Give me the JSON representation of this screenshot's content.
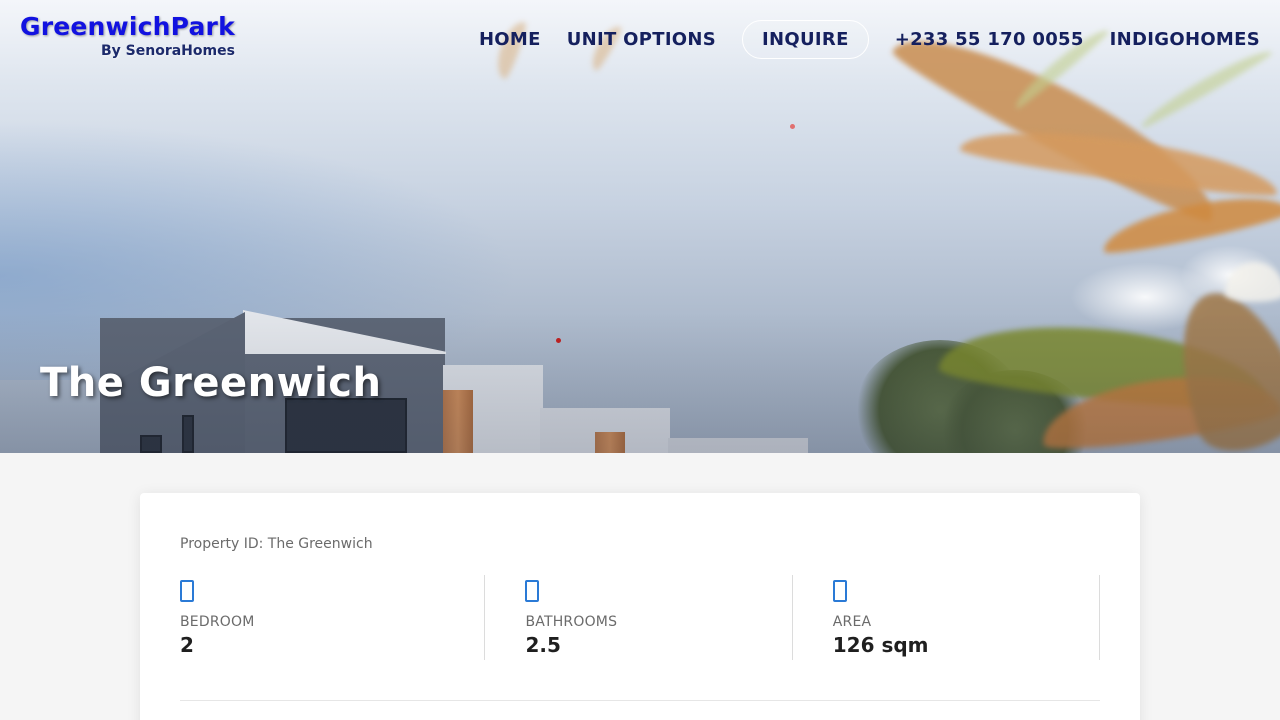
{
  "header": {
    "brand_name": "GreenwichPark",
    "brand_sub": "By SenoraHomes",
    "nav": [
      {
        "label": "HOME"
      },
      {
        "label": "UNIT OPTIONS"
      },
      {
        "label": "INQUIRE"
      },
      {
        "label": "+233 55 170 0055"
      },
      {
        "label": "INDIGOHOMES"
      }
    ]
  },
  "hero": {
    "title": "The Greenwich"
  },
  "property": {
    "id_text": "Property ID: The Greenwich",
    "stats": [
      {
        "icon": "bed-icon",
        "label": "BEDROOM",
        "value": "2"
      },
      {
        "icon": "bath-icon",
        "label": "BATHROOMS",
        "value": "2.5"
      },
      {
        "icon": "area-icon",
        "label": "AREA",
        "value": "126 sqm"
      }
    ]
  },
  "colors": {
    "brand": "#1212e0",
    "nav_text": "#15205e",
    "icon_accent": "#2a7ad6"
  }
}
